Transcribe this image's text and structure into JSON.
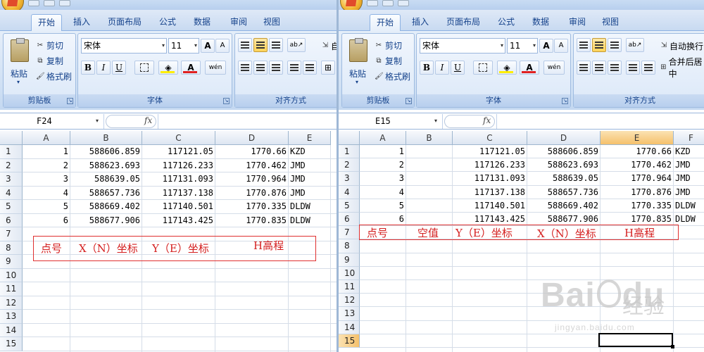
{
  "left": {
    "tabs": [
      "开始",
      "插入",
      "页面布局",
      "公式",
      "数据",
      "审阅",
      "视图"
    ],
    "clipboard": {
      "paste": "粘贴",
      "cut": "剪切",
      "copy": "复制",
      "format_painter": "格式刷",
      "label": "剪贴板"
    },
    "font": {
      "name": "宋体",
      "size": "11",
      "label": "字体",
      "bold": "B",
      "italic": "I",
      "underline": "U",
      "grow": "A",
      "shrink": "A",
      "phonetic": "wén"
    },
    "alignment": {
      "label": "对齐方式",
      "wrap": "自"
    },
    "name_box": "F24",
    "fx": "fx",
    "columns": [
      "A",
      "B",
      "C",
      "D",
      "E"
    ],
    "rows": [
      "1",
      "2",
      "3",
      "4",
      "5",
      "6",
      "7",
      "8",
      "9",
      "10",
      "11",
      "12",
      "13",
      "14",
      "15"
    ],
    "data": [
      [
        "1",
        "588606.859",
        "117121.05",
        "1770.66",
        "KZD"
      ],
      [
        "2",
        "588623.693",
        "117126.233",
        "1770.462",
        "JMD"
      ],
      [
        "3",
        "588639.05",
        "117131.093",
        "1770.964",
        "JMD"
      ],
      [
        "4",
        "588657.736",
        "117137.138",
        "1770.876",
        "JMD"
      ],
      [
        "5",
        "588669.402",
        "117140.501",
        "1770.335",
        "DLDW"
      ],
      [
        "6",
        "588677.906",
        "117143.425",
        "1770.835",
        "DLDW"
      ]
    ],
    "annotation": [
      "点号",
      "X（N）坐标",
      "Y（E）坐标",
      "H高程"
    ]
  },
  "right": {
    "tabs": [
      "开始",
      "插入",
      "页面布局",
      "公式",
      "数据",
      "审阅",
      "视图"
    ],
    "clipboard": {
      "paste": "粘贴",
      "cut": "剪切",
      "copy": "复制",
      "format_painter": "格式刷",
      "label": "剪贴板"
    },
    "font": {
      "name": "宋体",
      "size": "11",
      "label": "字体",
      "bold": "B",
      "italic": "I",
      "underline": "U",
      "grow": "A",
      "shrink": "A",
      "phonetic": "wén"
    },
    "alignment": {
      "label": "对齐方式",
      "wrap": "自动换行",
      "merge": "合并后居中"
    },
    "name_box": "E15",
    "fx": "fx",
    "columns": [
      "A",
      "B",
      "C",
      "D",
      "E",
      "F"
    ],
    "rows": [
      "1",
      "2",
      "3",
      "4",
      "5",
      "6",
      "7",
      "8",
      "9",
      "10",
      "11",
      "12",
      "13",
      "14",
      "15"
    ],
    "data": [
      [
        "1",
        "",
        "117121.05",
        "588606.859",
        "1770.66",
        "KZD"
      ],
      [
        "2",
        "",
        "117126.233",
        "588623.693",
        "1770.462",
        "JMD"
      ],
      [
        "3",
        "",
        "117131.093",
        "588639.05",
        "1770.964",
        "JMD"
      ],
      [
        "4",
        "",
        "117137.138",
        "588657.736",
        "1770.876",
        "JMD"
      ],
      [
        "5",
        "",
        "117140.501",
        "588669.402",
        "1770.335",
        "DLDW"
      ],
      [
        "6",
        "",
        "117143.425",
        "588677.906",
        "1770.835",
        "DLDW"
      ]
    ],
    "annotation": [
      "点号",
      "空值",
      "Y（E）坐标",
      "X（N）坐标",
      "H高程"
    ]
  },
  "watermark": {
    "brand": "Bai",
    "brand2": "du",
    "cn": "经验",
    "url": "jingyan.baidu.com"
  },
  "colors": {
    "accent": "#15428b",
    "annotation": "#d42020",
    "selected_header": "#f5c16c"
  }
}
